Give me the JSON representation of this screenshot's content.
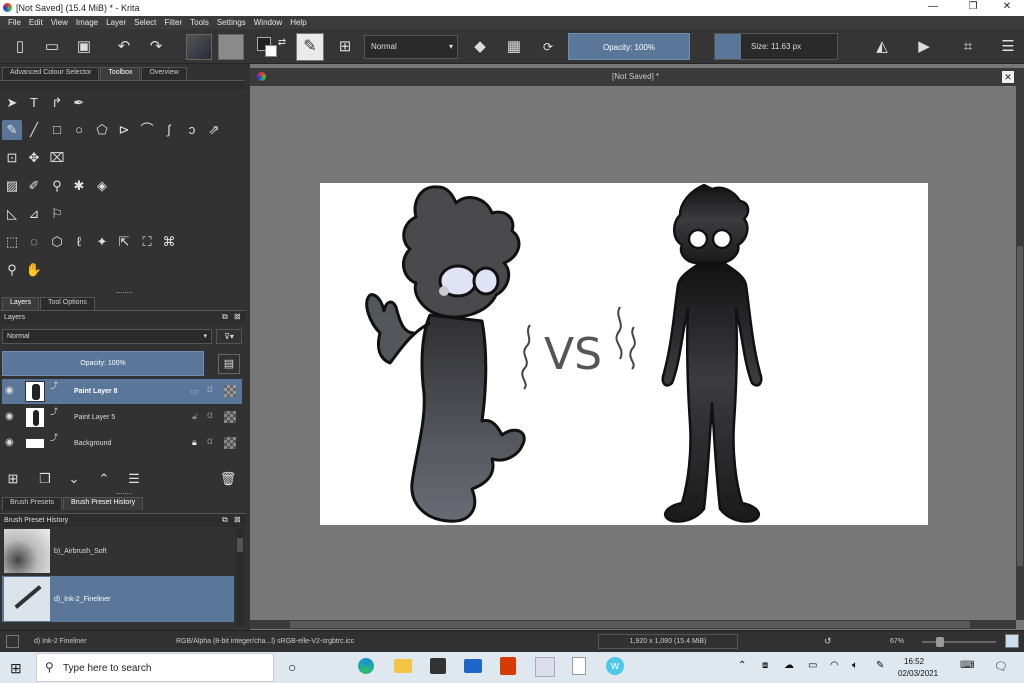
{
  "window": {
    "title": "[Not Saved]  (15.4 MiB)  * - Krita",
    "minimize": "—",
    "maximize": "❐",
    "close": "✕"
  },
  "menu": [
    "File",
    "Edit",
    "View",
    "Image",
    "Layer",
    "Select",
    "Filter",
    "Tools",
    "Settings",
    "Window",
    "Help"
  ],
  "toolbar": {
    "blend_mode": "Normal",
    "opacity": "Opacity: 100%",
    "size": "Size: 11.63 px"
  },
  "left_tabs": {
    "colour": "Advanced Colour Selector",
    "toolbox": "Toolbox",
    "overview": "Overview"
  },
  "docker_tabs": {
    "layers": "Layers",
    "tool_options": "Tool Options"
  },
  "layers": {
    "title": "Layers",
    "blend_mode": "Normal",
    "opacity": "Opacity:  100%",
    "items": [
      {
        "name": "Paint Layer 8"
      },
      {
        "name": "Paint Layer 5"
      },
      {
        "name": "Background"
      }
    ]
  },
  "preset_tabs": {
    "presets": "Brush Presets",
    "history": "Brush Preset History"
  },
  "preset_history": {
    "title": "Brush Preset History",
    "items": [
      {
        "name": "b)_Airbrush_Soft"
      },
      {
        "name": "d)_Ink-2_Fineliner"
      }
    ]
  },
  "document": {
    "tab_title": "[Not Saved]  *",
    "sketch_text": "VS"
  },
  "status": {
    "brush": "d) Ink-2 Fineliner",
    "color_space": "RGB/Alpha (8-bit integer/cha...l)  sRGB-elle-V2-srgbtrc.icc",
    "dimensions": "1,920 x 1,080 (15.4 MiB)",
    "zoom": "67%"
  },
  "taskbar": {
    "search_placeholder": "Type here to search",
    "time": "16:52",
    "date": "02/03/2021"
  },
  "colors": {
    "accent": "#5a7799",
    "canvas_bg": "#787878",
    "panel": "#323232"
  }
}
